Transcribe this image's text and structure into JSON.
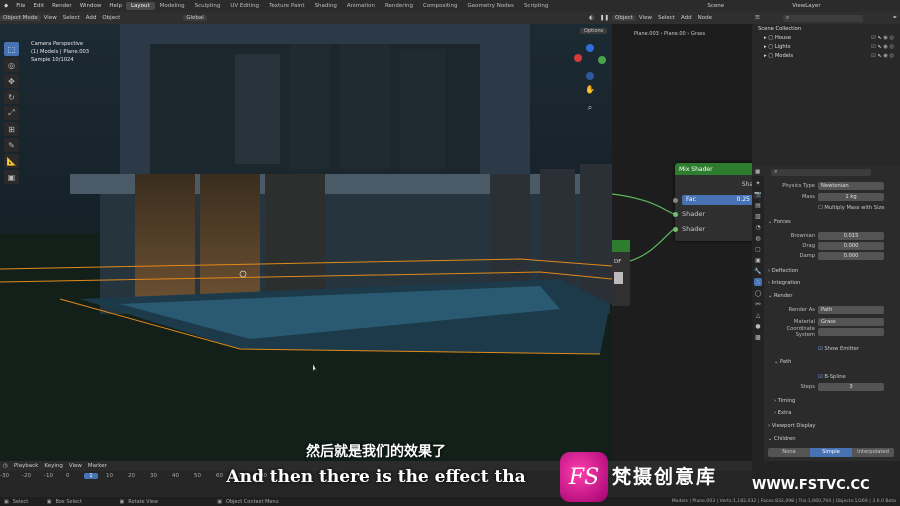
{
  "menu": [
    "File",
    "Edit",
    "Render",
    "Window",
    "Help"
  ],
  "workspaces": [
    "Layout",
    "Modeling",
    "Sculpting",
    "UV Editing",
    "Texture Paint",
    "Shading",
    "Animation",
    "Rendering",
    "Compositing",
    "Geometry Nodes",
    "Scripting"
  ],
  "scene_label": "Scene",
  "viewlayer_label": "ViewLayer",
  "viewport_header": {
    "mode": "Object Mode",
    "view": "View",
    "select": "Select",
    "add": "Add",
    "object": "Object",
    "orientation": "Global",
    "options": "Options"
  },
  "viewport_info": {
    "line1": "Camera Perspective",
    "line2": "(1) Models | Plane.003",
    "line3": "Sample 10/1024"
  },
  "node_header": {
    "object": "Object",
    "view": "View",
    "select": "Select",
    "add": "Add",
    "node": "Node"
  },
  "node_breadcrumb": [
    "Plane.003",
    "Plane.00",
    "Grass"
  ],
  "mix_node": {
    "title": "Mix Shader",
    "out": "Sha",
    "fac_label": "Fac",
    "fac_value": "0.25",
    "shader1": "Shader",
    "shader2": "Shader"
  },
  "bsdf_partial": "DF",
  "outliner": {
    "root": "Scene Collection",
    "items": [
      "House",
      "Lights",
      "Models"
    ]
  },
  "props": {
    "physics_type_label": "Physics Type",
    "physics_type": "Newtonian",
    "mass_label": "Mass",
    "mass": "1 kg",
    "multiply_mass": "Multiply Mass with Size",
    "forces": "Forces",
    "brownian_label": "Brownian",
    "brownian": "0.015",
    "drag_label": "Drag",
    "drag": "0.000",
    "damp_label": "Damp",
    "damp": "0.000",
    "deflection": "Deflection",
    "integration": "Integration",
    "render": "Render",
    "render_as_label": "Render As",
    "render_as": "Path",
    "material_label": "Material",
    "material": "Grass",
    "coord_label": "Coordinate System",
    "show_emitter": "Show Emitter",
    "path": "Path",
    "bspline": "B-Spline",
    "steps_label": "Steps",
    "steps": "3",
    "timing": "Timing",
    "extra": "Extra",
    "viewport_display": "Viewport Display",
    "children": "Children",
    "child_none": "None",
    "child_simple": "Simple",
    "child_interp": "Interpolated"
  },
  "timeline": {
    "playback": "Playback",
    "keying": "Keying",
    "view": "View",
    "marker": "Marker",
    "ticks": [
      "-30",
      "-20",
      "-10",
      "0",
      "1",
      "10",
      "20",
      "30",
      "40",
      "50",
      "60",
      "70",
      "80"
    ],
    "current": "1"
  },
  "status": {
    "select": "Select",
    "box": "Box Select",
    "rotate": "Rotate View",
    "ctx": "Object Context Menu",
    "right": "Models | Plane.003 | Verts:1,182,032 | Faces:832,098 | Tris:1,660,704 | Objects:1/269 | 3.0.0 Beta"
  },
  "subtitle_cn": "然后就是我们的效果了",
  "subtitle_en": "And then there is the effect tha",
  "watermark": {
    "logo": "FS",
    "text": "梵摄创意库",
    "url": "WWW.FSTVC.CC"
  }
}
